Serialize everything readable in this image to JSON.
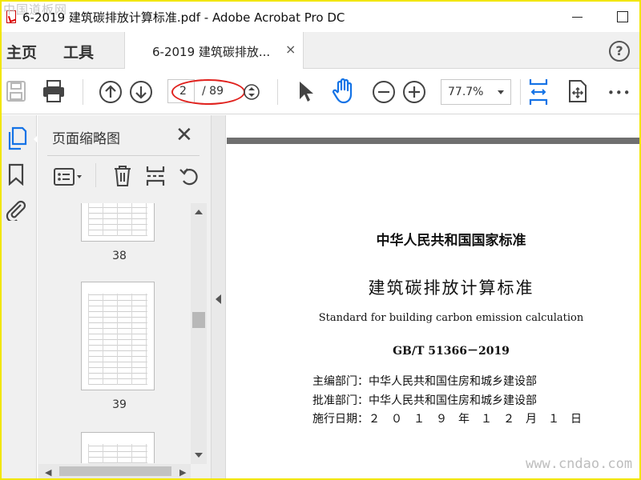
{
  "window": {
    "title": "6-2019 建筑碳排放计算标准.pdf - Adobe Acrobat Pro DC",
    "watermark_top": "中国道板网",
    "watermark_bottom": "www.cndao.com"
  },
  "tabs": {
    "home": "主页",
    "tools": "工具",
    "document": "6-2019 建筑碳排放...",
    "close": "×",
    "help": "?"
  },
  "toolbar": {
    "page_current": "2",
    "page_total": "/ 89",
    "zoom": "77.7%",
    "more": "•••",
    "highlight_color": "#e0221e",
    "accent_color": "#1473e6"
  },
  "thumbnails": {
    "title": "页面缩略图",
    "close": "✕",
    "pages": [
      "38",
      "39"
    ]
  },
  "document": {
    "line1": "中华人民共和国国家标准",
    "line2": "建筑碳排放计算标准",
    "line3": "Standard for building carbon emission calculation",
    "line4": "GB/T 51366－2019",
    "meta1": "主编部门：中华人民共和国住房和城乡建设部",
    "meta2": "批准部门：中华人民共和国住房和城乡建设部",
    "meta3": "施行日期：２　０　１　９　年　１　２　月　１　日"
  }
}
